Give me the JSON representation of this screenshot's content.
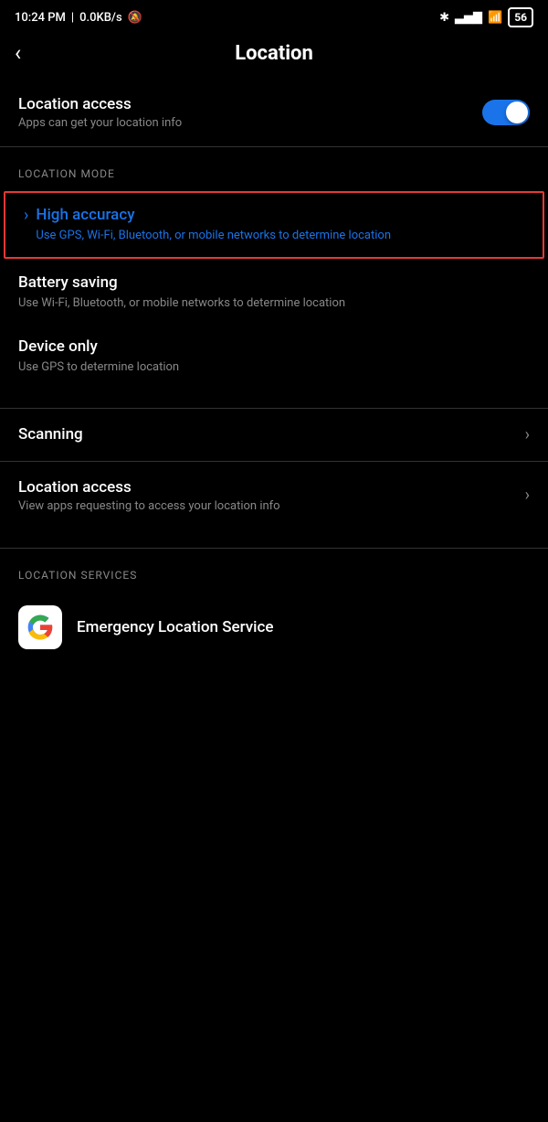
{
  "statusBar": {
    "time": "10:24 PM",
    "network": "0.0KB/s",
    "battery": "56"
  },
  "header": {
    "backLabel": "‹",
    "title": "Location"
  },
  "locationAccess": {
    "label": "Location access",
    "sublabel": "Apps can get your location info",
    "toggleEnabled": true
  },
  "locationMode": {
    "sectionHeader": "LOCATION MODE",
    "items": [
      {
        "id": "high-accuracy",
        "title": "High accuracy",
        "description": "Use GPS, Wi-Fi, Bluetooth, or mobile networks to determine location",
        "highlighted": true
      },
      {
        "id": "battery-saving",
        "title": "Battery saving",
        "description": "Use Wi-Fi, Bluetooth, or mobile networks to determine location",
        "highlighted": false
      },
      {
        "id": "device-only",
        "title": "Device only",
        "description": "Use GPS to determine location",
        "highlighted": false
      }
    ]
  },
  "menuItems": [
    {
      "id": "scanning",
      "title": "Scanning",
      "subtitle": ""
    },
    {
      "id": "location-access",
      "title": "Location access",
      "subtitle": "View apps requesting to access your location info"
    }
  ],
  "locationServices": {
    "sectionHeader": "LOCATION SERVICES",
    "items": [
      {
        "id": "emergency-location",
        "title": "Emergency Location Service",
        "icon": "G"
      }
    ]
  }
}
